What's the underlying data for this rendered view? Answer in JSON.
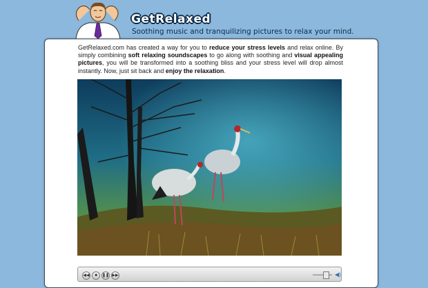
{
  "header": {
    "logo_text": "GetRelaxed",
    "tagline": "Soothing music and tranquilizing pictures to relax your mind."
  },
  "intro": {
    "p1": "GetRelaxed.com has created a way for you to ",
    "b1": "reduce your stress levels",
    "p2": " and relax online. By simply combining ",
    "b2": "soft relaxing soundscapes",
    "p3": " to go along with soothing and ",
    "b3": "visual appealing pictures",
    "p4": ", you will be transformed into a soothing bliss and your stress level will drop almost instantly. Now, just sit back and ",
    "b4": "enjoy the relaxation",
    "p5": "."
  },
  "player": {
    "icons": [
      "rewind-icon",
      "stop-icon",
      "pause-icon",
      "forward-icon",
      "speaker-icon"
    ]
  },
  "colors": {
    "background": "#8bb8dc",
    "panel": "#ffffff",
    "tagline": "#0d2c4f"
  }
}
